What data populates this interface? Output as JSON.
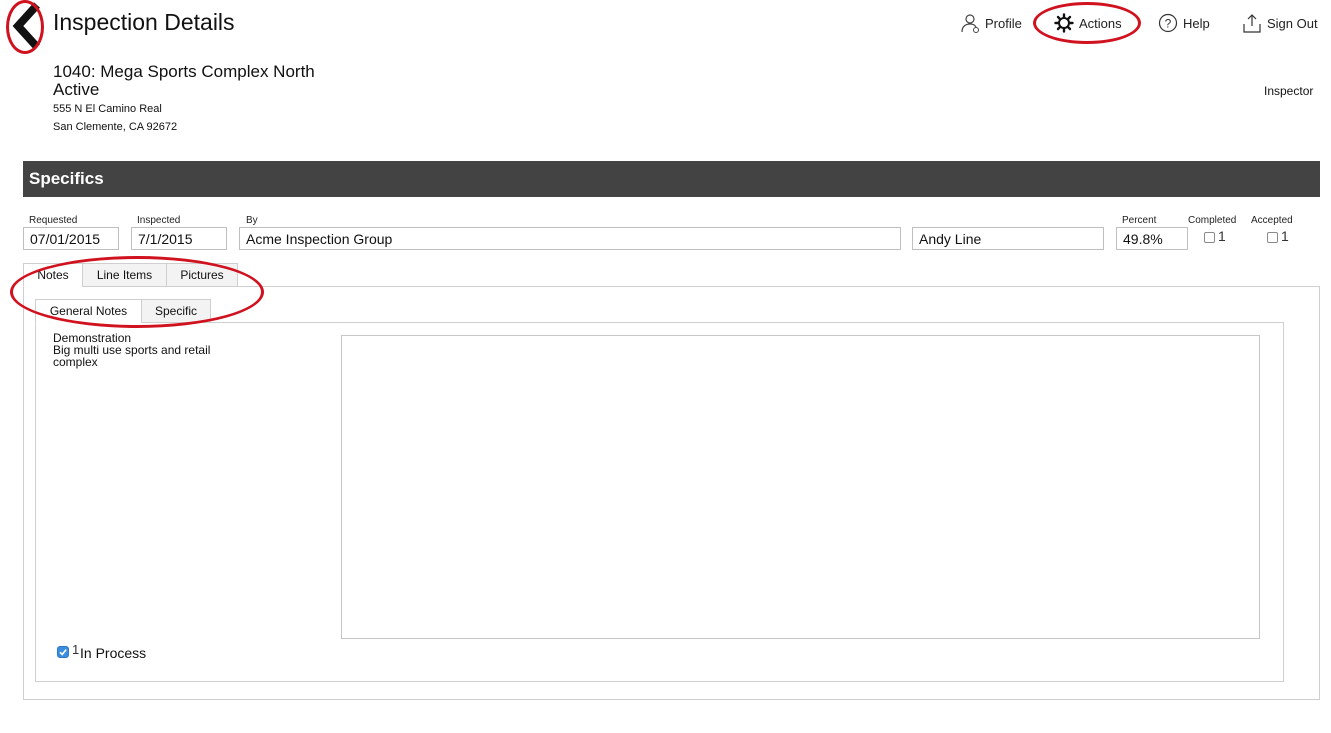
{
  "header": {
    "title": "Inspection Details",
    "nav": [
      {
        "label": "Profile",
        "icon": "profile-icon"
      },
      {
        "label": "Actions",
        "icon": "gear-icon"
      },
      {
        "label": "Help",
        "icon": "help-icon"
      },
      {
        "label": "Sign Out",
        "icon": "sign-out-icon"
      }
    ]
  },
  "property": {
    "name": "1040: Mega Sports Complex North",
    "status": "Active",
    "address_line1": "555 N El Camino Real",
    "address_line2": "San Clemente, CA  92672",
    "role": "Inspector"
  },
  "specifics": {
    "section_title": "Specifics",
    "requested": {
      "label": "Requested",
      "value": "07/01/2015"
    },
    "inspected": {
      "label": "Inspected",
      "value": "7/1/2015"
    },
    "by": {
      "label": "By",
      "value": "Acme Inspection Group"
    },
    "inspector_name": {
      "value": "Andy Line"
    },
    "percent": {
      "label": "Percent",
      "value": "49.8%"
    },
    "completed": {
      "label": "Completed",
      "count": "1",
      "checked": false
    },
    "accepted": {
      "label": "Accepted",
      "count": "1",
      "checked": false
    }
  },
  "tabs": [
    {
      "label": "Notes",
      "active": true
    },
    {
      "label": "Line Items",
      "active": false
    },
    {
      "label": "Pictures",
      "active": false
    }
  ],
  "subtabs": [
    {
      "label": "General Notes",
      "active": true
    },
    {
      "label": "Specific",
      "active": false
    }
  ],
  "notes": {
    "line1": "Demonstration",
    "line2": "Big multi use sports and retail complex",
    "textarea_value": ""
  },
  "in_process": {
    "count": "1",
    "label": "In Process",
    "checked": true
  },
  "colors": {
    "section_bar": "#434343",
    "highlight": "#d0121f",
    "checkbox_accent": "#3b8ddf"
  }
}
